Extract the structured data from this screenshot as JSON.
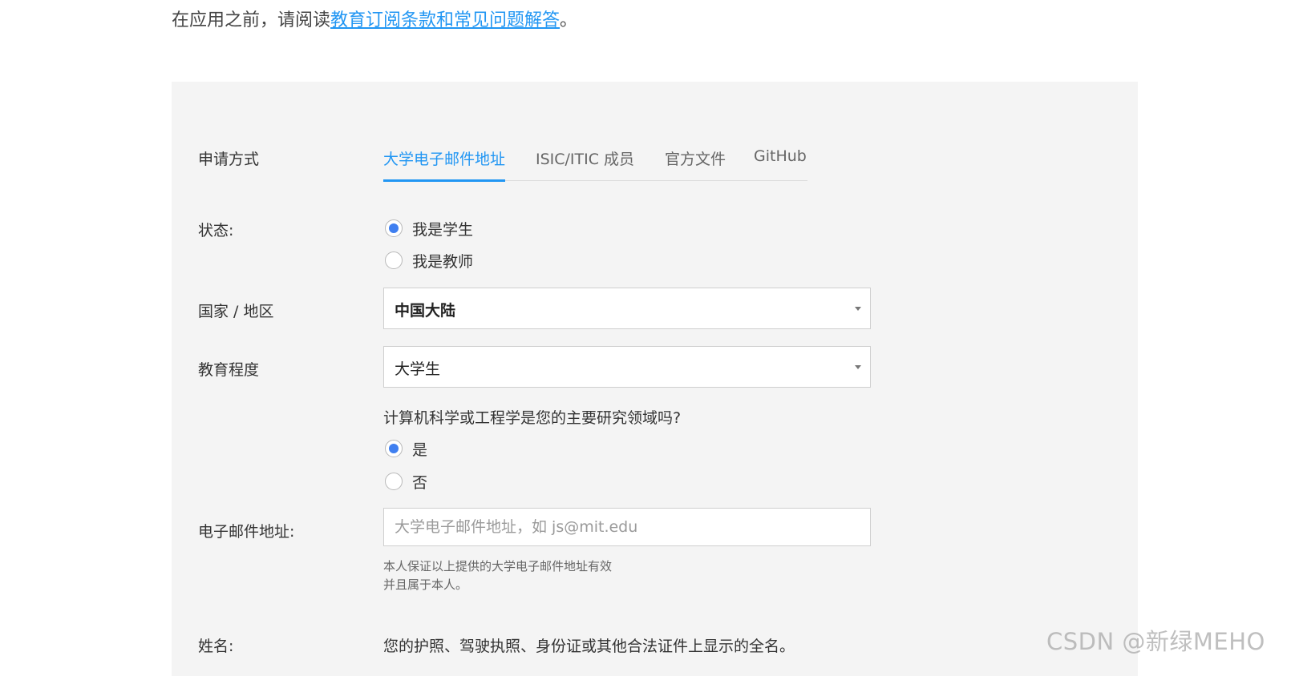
{
  "intro": {
    "prefix": "在应用之前，请阅读",
    "link": "教育订阅条款和常见问题解答",
    "suffix": "。"
  },
  "form": {
    "method_label": "申请方式",
    "tabs": [
      {
        "label": "大学电子邮件地址",
        "active": true
      },
      {
        "label": "ISIC/ITIC 成员",
        "active": false
      },
      {
        "label": "官方文件",
        "active": false
      },
      {
        "label": "GitHub",
        "active": false
      }
    ],
    "status_label": "状态:",
    "status_options": [
      {
        "label": "我是学生",
        "checked": true
      },
      {
        "label": "我是教师",
        "checked": false
      }
    ],
    "country_label": "国家 / 地区",
    "country_value": "中国大陆",
    "education_label": "教育程度",
    "education_value": "大学生",
    "cs_question": "计算机科学或工程学是您的主要研究领域吗?",
    "cs_options": [
      {
        "label": "是",
        "checked": true
      },
      {
        "label": "否",
        "checked": false
      }
    ],
    "email_label": "电子邮件地址:",
    "email_placeholder": "大学电子邮件地址，如 js@mit.edu",
    "email_hint_line1": "本人保证以上提供的大学电子邮件地址有效",
    "email_hint_line2": "并且属于本人。",
    "name_label": "姓名:",
    "name_desc": "您的护照、驾驶执照、身份证或其他合法证件上显示的全名。"
  },
  "watermark": "CSDN @新绿MEHO",
  "colors": {
    "accent": "#2196f3",
    "radio_checked": "#3f7ff0",
    "panel_bg": "#f4f4f4"
  }
}
